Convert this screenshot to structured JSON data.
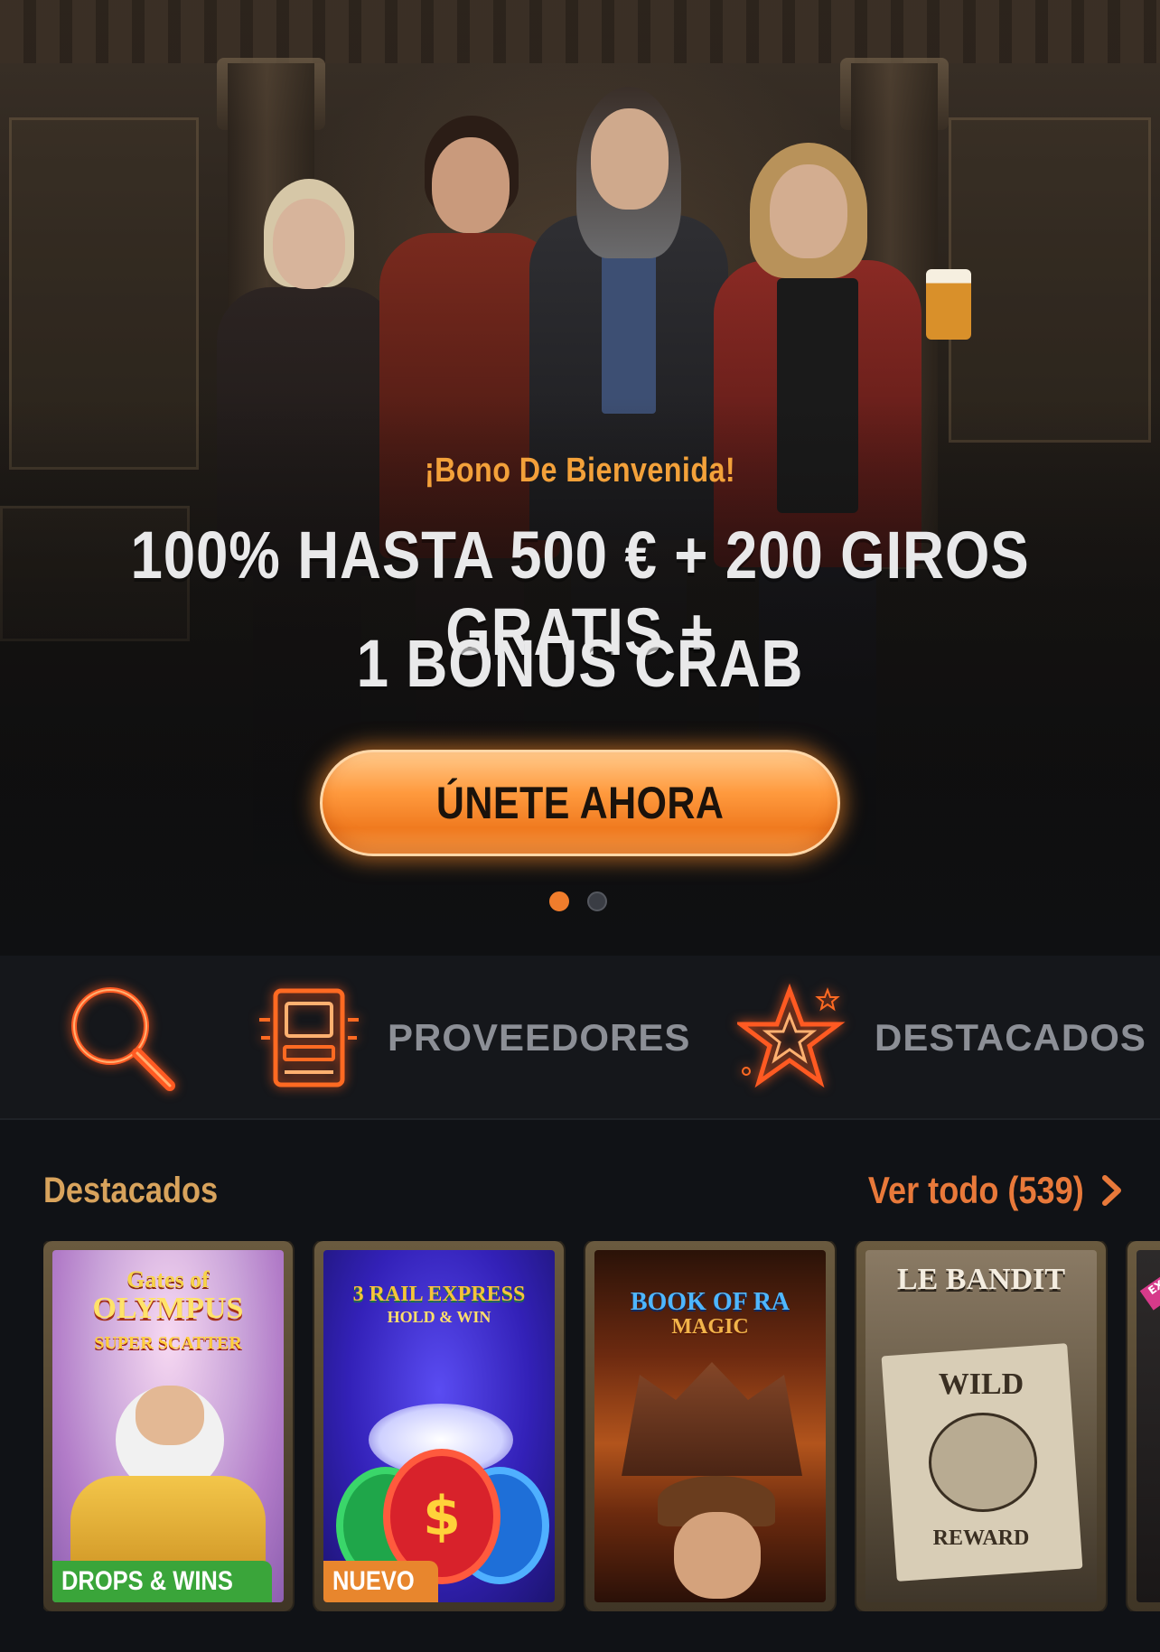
{
  "hero": {
    "subtitle": "¡Bono De Bienvenida!",
    "title_line1": "100% HASTA 500 € + 200 GIROS GRATIS +",
    "title_line2": "1 BONUS CRAB",
    "cta_label": "ÚNETE AHORA",
    "slides_total": 2,
    "active_slide": 1,
    "accent_color": "#f07d2c"
  },
  "quick_nav": {
    "search_icon": "search-icon",
    "providers_icon": "arcade-machine-icon",
    "providers_label": "PROVEEDORES",
    "featured_icon": "star-icon",
    "featured_label": "DESTACADOS"
  },
  "featured": {
    "title": "Destacados",
    "see_all": "Ver todo (539)",
    "see_all_icon": "chevron-right-icon",
    "games": [
      {
        "name": "Gates of Olympus Super Scatter",
        "art_line1": "Gates of",
        "art_line2": "OLYMPUS",
        "art_line3": "SUPER SCATTER",
        "badge": "DROPS & WINS",
        "badge_color": "#3aa53a"
      },
      {
        "name": "3 Rail Express Hold & Win",
        "art_line1": "3 RAIL EXPRESS",
        "art_line2": "HOLD & WIN",
        "badge": "NUEVO",
        "badge_color": "#e8862d"
      },
      {
        "name": "Book of Ra Magic",
        "art_line1": "BOOK OF RA",
        "art_line2": "MAGIC"
      },
      {
        "name": "Le Bandit",
        "art_line1": "LE BANDIT",
        "art_line2": "WILD",
        "art_line3": "REWARD"
      },
      {
        "name": "Exclusive game",
        "art_line1": "EXCL"
      }
    ]
  }
}
